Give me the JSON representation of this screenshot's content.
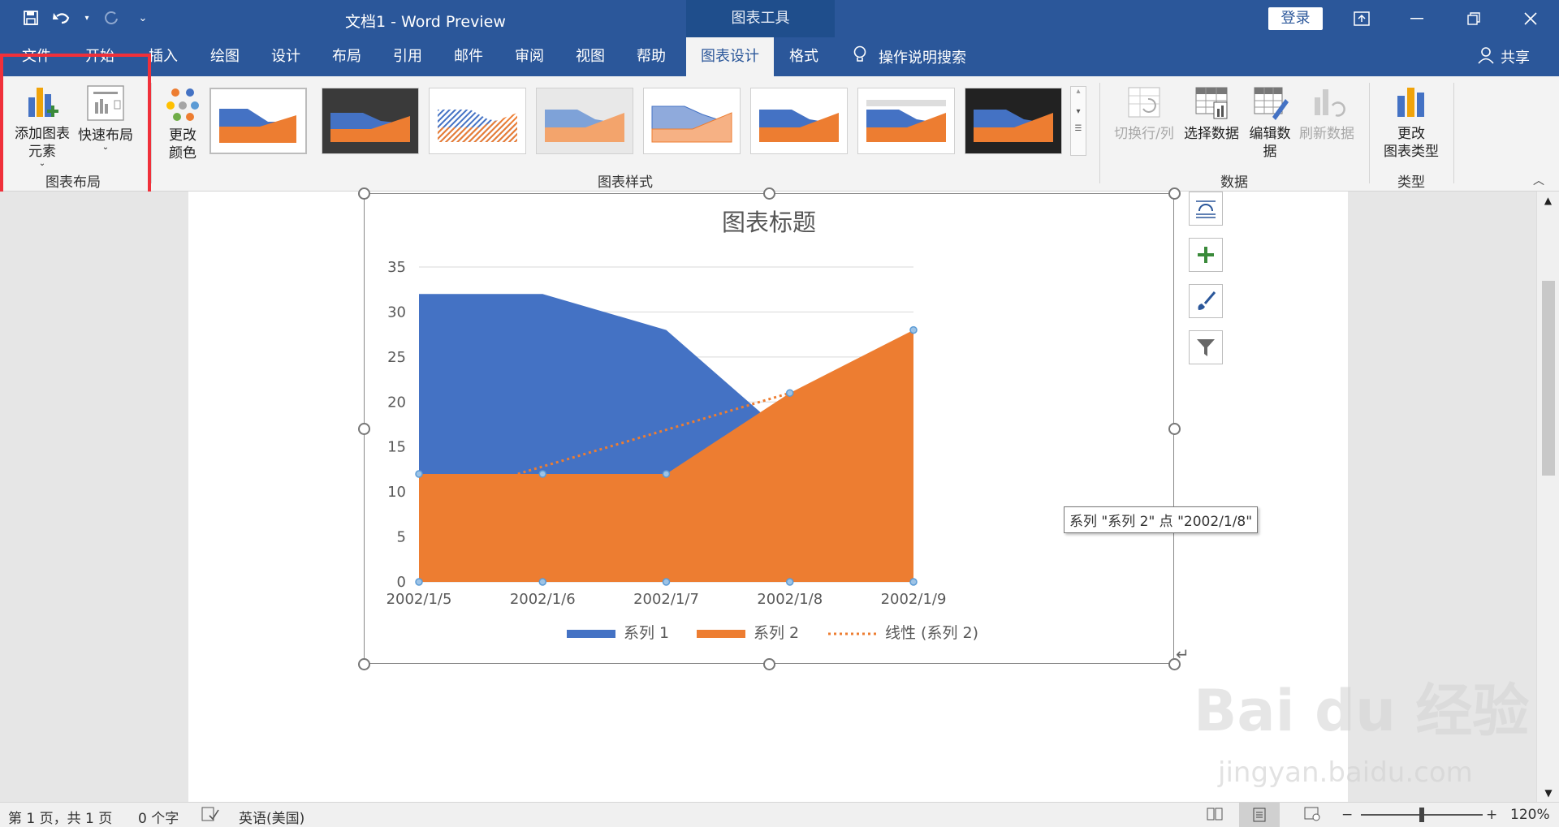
{
  "window": {
    "title": "文档1  -  Word Preview",
    "context_tab": "图表工具",
    "login_label": "登录"
  },
  "tabs": [
    {
      "label": "文件"
    },
    {
      "label": "开始"
    },
    {
      "label": "插入"
    },
    {
      "label": "绘图"
    },
    {
      "label": "设计"
    },
    {
      "label": "布局"
    },
    {
      "label": "引用"
    },
    {
      "label": "邮件"
    },
    {
      "label": "审阅"
    },
    {
      "label": "视图"
    },
    {
      "label": "帮助"
    },
    {
      "label": "图表设计"
    },
    {
      "label": "格式"
    }
  ],
  "search_label": "操作说明搜索",
  "share_label": "共享",
  "ribbon": {
    "add_element": "添加图表\n元素",
    "quick_layout": "快速布局",
    "change_color": "更改\n颜色",
    "group_layout": "图表布局",
    "group_styles": "图表样式",
    "switch_row_col": "切换行/列",
    "select_data": "选择数据",
    "edit_data": "编辑数\n据",
    "refresh_data": "刷新数据",
    "group_data": "数据",
    "change_type": "更改\n图表类型",
    "group_type": "类型"
  },
  "chart_data": {
    "type": "area",
    "title": "图表标题",
    "categories": [
      "2002/1/5",
      "2002/1/6",
      "2002/1/7",
      "2002/1/8",
      "2002/1/9"
    ],
    "series": [
      {
        "name": "系列 1",
        "values": [
          32,
          32,
          28,
          16,
          12
        ],
        "color": "#4472c4"
      },
      {
        "name": "系列 2",
        "values": [
          12,
          12,
          12,
          21,
          28
        ],
        "color": "#ed7d31"
      }
    ],
    "trendline": {
      "name": "线性 (系列 2)",
      "from": [
        12,
        12
      ],
      "to": [
        21,
        21
      ],
      "style": "dotted",
      "color": "#ed7d31"
    },
    "y_ticks": [
      "35",
      "30",
      "25",
      "20",
      "15",
      "10",
      "5",
      "0"
    ],
    "ylim": [
      0,
      35
    ],
    "grid": true,
    "legend_position": "bottom"
  },
  "tooltip": "系列 \"系列 2\" 点 \"2002/1/8\"",
  "status": {
    "page": "第 1 页，共 1 页",
    "words": "0 个字",
    "language": "英语(美国)",
    "zoom": "120%"
  },
  "watermark": {
    "brand": "Bai du 经验",
    "url": "jingyan.baidu.com"
  }
}
